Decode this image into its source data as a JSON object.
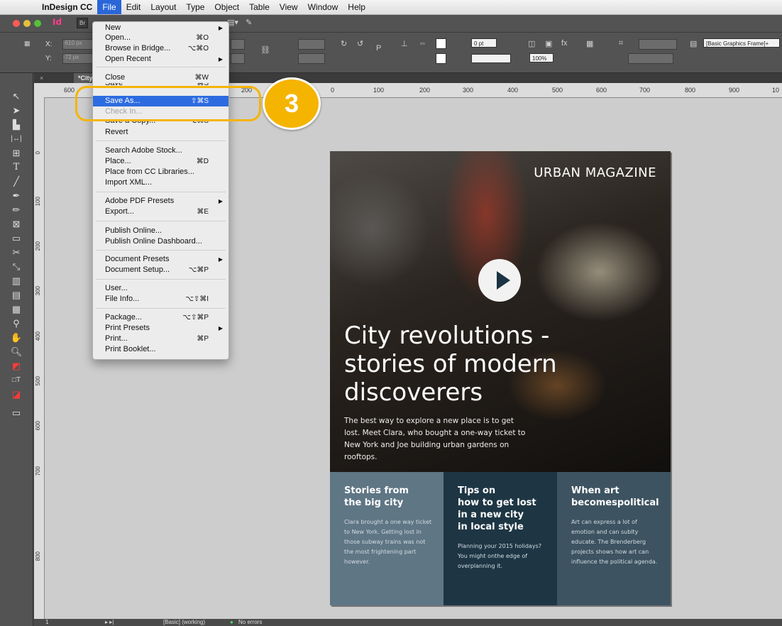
{
  "menubar": {
    "app_name": "InDesign CC",
    "items": [
      "File",
      "Edit",
      "Layout",
      "Type",
      "Object",
      "Table",
      "View",
      "Window",
      "Help"
    ],
    "active": "File"
  },
  "app": {
    "logo": "Id",
    "document_tab": "*Citystories.in"
  },
  "control_panel": {
    "x_label": "X:",
    "x_value": "-610 px",
    "y_label": "Y:",
    "y_value": "-72 px",
    "stroke_weight": "0 pt",
    "opacity": "100%",
    "object_style": "[Basic Graphics Frame]+"
  },
  "ruler": {
    "h_ticks": [
      "600",
      "200",
      "0",
      "100",
      "200",
      "300",
      "400",
      "500",
      "600",
      "700",
      "800",
      "900",
      "10"
    ],
    "v_ticks": [
      "0",
      "100",
      "200",
      "300",
      "400",
      "500",
      "600",
      "700",
      "800"
    ]
  },
  "file_menu": {
    "items": [
      {
        "label": "New",
        "shortcut": "",
        "submenu": true
      },
      {
        "label": "Open...",
        "shortcut": "⌘O"
      },
      {
        "label": "Browse in Bridge...",
        "shortcut": "⌥⌘O"
      },
      {
        "label": "Open Recent",
        "shortcut": "",
        "submenu": true
      },
      {
        "label": "Close",
        "shortcut": "⌘W"
      },
      {
        "label": "Save",
        "shortcut": "⌘S"
      },
      {
        "label": "Save As...",
        "shortcut": "⇧⌘S",
        "highlighted": true
      },
      {
        "label": "Check In...",
        "shortcut": "",
        "disabled": true
      },
      {
        "label": "Save a Copy...",
        "shortcut": "⌥⌘S"
      },
      {
        "label": "Revert",
        "shortcut": ""
      },
      {
        "label": "Search Adobe Stock...",
        "shortcut": ""
      },
      {
        "label": "Place...",
        "shortcut": "⌘D"
      },
      {
        "label": "Place from CC Libraries...",
        "shortcut": ""
      },
      {
        "label": "Import XML...",
        "shortcut": ""
      },
      {
        "label": "Adobe PDF Presets",
        "shortcut": "",
        "submenu": true
      },
      {
        "label": "Export...",
        "shortcut": "⌘E"
      },
      {
        "label": "Publish Online...",
        "shortcut": ""
      },
      {
        "label": "Publish Online Dashboard...",
        "shortcut": ""
      },
      {
        "label": "Document Presets",
        "shortcut": "",
        "submenu": true
      },
      {
        "label": "Document Setup...",
        "shortcut": "⌥⌘P"
      },
      {
        "label": "User...",
        "shortcut": ""
      },
      {
        "label": "File Info...",
        "shortcut": "⌥⇧⌘I"
      },
      {
        "label": "Package...",
        "shortcut": "⌥⇧⌘P"
      },
      {
        "label": "Print Presets",
        "shortcut": "",
        "submenu": true
      },
      {
        "label": "Print...",
        "shortcut": "⌘P"
      },
      {
        "label": "Print Booklet...",
        "shortcut": ""
      }
    ]
  },
  "annotation": {
    "step_number": "3",
    "color": "#f5b400"
  },
  "magazine": {
    "brand": "URBAN MAGAZINE",
    "headline_line1": "City revolutions -",
    "headline_line2": "stories of modern",
    "headline_line3": "discoverers",
    "intro": "The best way to explore a new place is to get lost. Meet Clara, who bought a one-way ticket to New York and Joe building urban gardens on rooftops.",
    "columns": [
      {
        "title_line1": "Stories from",
        "title_line2": "the big city",
        "text": "Clara brought a one way ticket to New York. Getting lost in those subway trains was not the most frightening part however.",
        "color": "#5f7685"
      },
      {
        "title_line1": "Tips on",
        "title_line2": "how to get lost",
        "title_line3": "in a new city",
        "title_line4": "in local style",
        "text": "Planning your 2015 holidays? You might onthe edge of overplanning it.",
        "color": "#1e3644"
      },
      {
        "title_line1": "When art",
        "title_line2": "becomespolitical",
        "text": "Art can express a lot of emotion and can sublty educate. The Brenderberg projects shows how art can influence the political agenda.",
        "color": "#3d5361"
      }
    ]
  },
  "statusbar": {
    "page": "1",
    "mode": "[Basic] (working)",
    "errors": "No errors"
  }
}
